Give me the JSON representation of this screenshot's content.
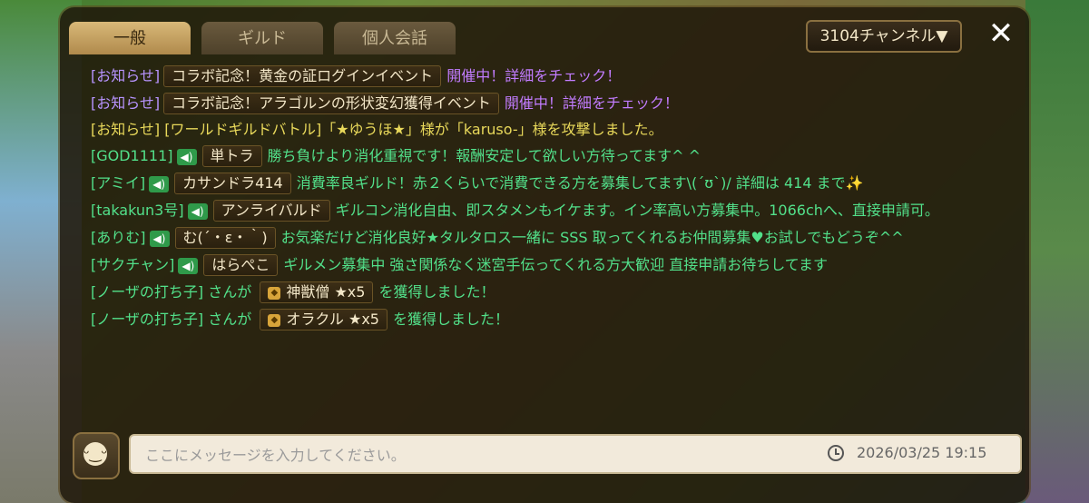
{
  "tabs": [
    {
      "label": "一般",
      "active": true
    },
    {
      "label": "ギルド",
      "active": false
    },
    {
      "label": "個人会話",
      "active": false
    }
  ],
  "channel": "3104チャンネル▼",
  "close_glyph": "✕",
  "messages": [
    {
      "sender": "[お知らせ]",
      "tag": "コラボ記念！黄金の証ログインイベント",
      "text": "開催中！詳細をチェック！"
    },
    {
      "sender": "[お知らせ]",
      "tag": "コラボ記念！アラゴルンの形状変幻獲得イベント",
      "text": "開催中！詳細をチェック！"
    },
    {
      "text": "[お知らせ] [ワールドギルドバトル]「★ゆうほ★」様が「karuso-」様を攻撃しました。"
    },
    {
      "sender": "[GOD1111]",
      "tag": "単トラ",
      "text": "勝ち負けより消化重視です！報酬安定して欲しい方待ってます^ ^"
    },
    {
      "sender": "[アミイ]",
      "tag": "カサンドラ414",
      "text": "消費率良ギルド！赤２くらいで消費できる方を募集してます\\(´ʊ`)/ 詳細は 414 まで✨"
    },
    {
      "sender": "[takakun3号]",
      "tag": "アンライバルド",
      "text": "ギルコン消化自由、即スタメンもイケます。イン率高い方募集中。1066chへ、直接申請可。"
    },
    {
      "sender": "[ありむ]",
      "tag": "む(´・ε・｀)",
      "text": "お気楽だけど消化良好★タルタロス一緒に SSS 取ってくれるお仲間募集♥お試しでもどうぞ^^"
    },
    {
      "sender": "[サクチャン]",
      "tag": "はらぺこ",
      "text": "ギルメン募集中 強さ関係なく迷宮手伝ってくれる方大歓迎 直接申請お待ちしてます"
    },
    {
      "sender": "[ノーザの打ち子]",
      "mid": "さんが",
      "item": "神獣僧 ★x5",
      "text": "を獲得しました！"
    },
    {
      "sender": "[ノーザの打ち子]",
      "mid": "さんが",
      "item": "オラクル ★x5",
      "text": "を獲得しました！"
    }
  ],
  "input": {
    "placeholder": "ここにメッセージを入力してください。",
    "value": ""
  },
  "timestamp": "2026/03/25  19:15",
  "icons": {
    "megaphone": "megaphone-icon",
    "clock": "clock-icon",
    "emoji": "emoji-icon",
    "item": "item-icon"
  },
  "colors": {
    "purple": "#c27cff",
    "yellow": "#e8d85a",
    "green": "#52e08a",
    "panel": "#20180a"
  }
}
